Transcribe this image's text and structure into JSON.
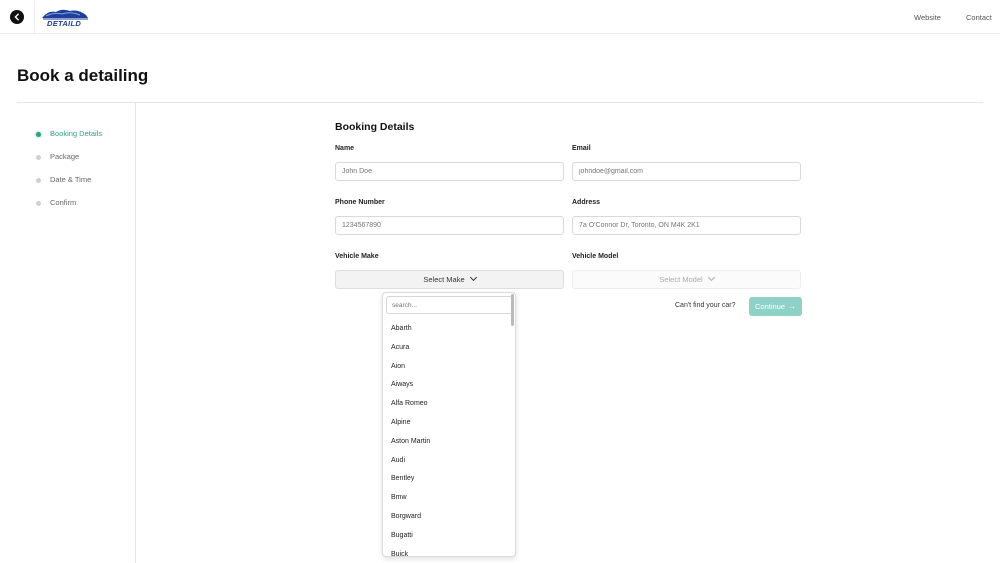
{
  "header": {
    "logo_text": "DETAILD",
    "nav": {
      "website": "Website",
      "contact": "Contact"
    }
  },
  "page": {
    "title": "Book a detailing"
  },
  "steps": [
    {
      "label": "Booking Details",
      "active": true
    },
    {
      "label": "Package",
      "active": false
    },
    {
      "label": "Date & Time",
      "active": false
    },
    {
      "label": "Confirm",
      "active": false
    }
  ],
  "form": {
    "section_title": "Booking Details",
    "name": {
      "label": "Name",
      "placeholder": "John Doe"
    },
    "email": {
      "label": "Email",
      "placeholder": "johndoe@gmail.com"
    },
    "phone": {
      "label": "Phone Number",
      "placeholder": "1234567890"
    },
    "address": {
      "label": "Address",
      "placeholder": "7a O'Connor Dr, Toronto, ON M4K 2K1"
    },
    "make": {
      "label": "Vehicle Make",
      "value": "Select Make"
    },
    "model": {
      "label": "Vehicle Model",
      "value": "Select Model"
    },
    "cant_find": "Can't find your car?",
    "continue": "Continue"
  },
  "make_dropdown": {
    "search_placeholder": "search...",
    "options": [
      "Abarth",
      "Acura",
      "Aion",
      "Aiways",
      "Alfa Romeo",
      "Alpine",
      "Aston Martin",
      "Audi",
      "Bentley",
      "Bmw",
      "Borgward",
      "Bugatti",
      "Buick"
    ]
  },
  "colors": {
    "accent": "#2f9e88",
    "continue_bg": "#8fd1c6",
    "logo": "#1f3f9a"
  }
}
